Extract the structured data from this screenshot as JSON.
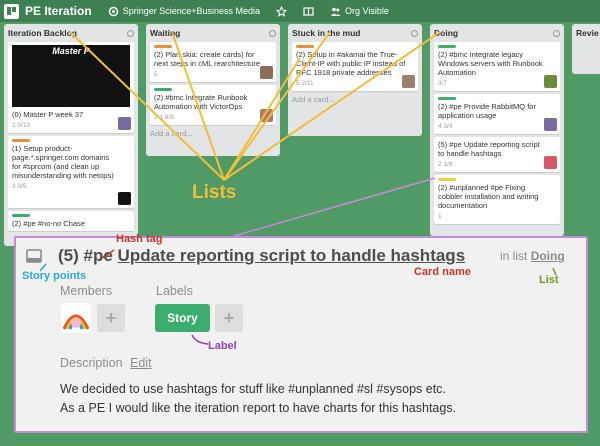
{
  "header": {
    "board_title": "PE Iteration",
    "org": "Springer Science+Business Media",
    "visibility": "Org Visible"
  },
  "lists": {
    "backlog": {
      "title": "Iteration Backlog",
      "cards": [
        {
          "cover_text": "Master P",
          "text": "(0) Master P week 37",
          "badges": "1   0/10"
        },
        {
          "text": "(1) Setup product-page.*.springer.com domains for #sprcom (and clean up misunderstanding with netops)",
          "badges": "3   0/5"
        },
        {
          "text": "(2) #pe #no-no Chase"
        }
      ]
    },
    "waiting": {
      "title": "Waiting",
      "cards": [
        {
          "text": "(2) Plan skia: create cards) for next steps in cML rearchitecture",
          "badges": "5"
        },
        {
          "text": "(2) #bmc Integrate Runbook Automation with VictorOps",
          "badges": "2   1   6/9"
        }
      ],
      "add": "Add a card..."
    },
    "stuck": {
      "title": "Stuck in the mud",
      "cards": [
        {
          "text": "(2) Setup in #akamai the True-Client-IP with public IP instead of RFC 1918 private addresses",
          "badges": "5   2/11"
        }
      ],
      "add": "Add a card..."
    },
    "doing": {
      "title": "Doing",
      "cards": [
        {
          "text": "(2) #bmc Integrate legacy Windows servers with Runbook Automation",
          "badges": "3/7"
        },
        {
          "text": "(2) #pe Provide RabbitMQ for application usage",
          "badges": "4   3/4"
        },
        {
          "text": "(5) #pe Update reporting script to handle hashtags",
          "badges": "2   1/8"
        },
        {
          "text": "(2) #unplanned #pe Fixing cobbler installation and writing documentation",
          "badges": "1"
        }
      ]
    },
    "review": {
      "title": "Revie"
    }
  },
  "annotations": {
    "lists": "Lists",
    "hash_tag": "Hash tag",
    "story_points": "Story points",
    "card_name": "Card name",
    "list": "List",
    "label": "Label"
  },
  "detail": {
    "points": "(5)",
    "hashtag": "#pe",
    "name": "Update reporting script to handle hashtags",
    "in_list_prefix": "in list",
    "list_name": "Doing",
    "members_label": "Members",
    "labels_label": "Labels",
    "label_value": "Story",
    "description_label": "Description",
    "edit_label": "Edit",
    "description_line1": "We decided to use hashtags for stuff like #unplanned #sl #sysops etc.",
    "description_line2": "As a PE I would like the iteration report to have charts for this hashtags."
  },
  "colors": {
    "board_bg": "#509a66",
    "label_green": "#3cad6e",
    "label_orange": "#e5913a",
    "label_yellow": "#f0cc38",
    "annotation_yellow": "#f2bd3b",
    "annotation_purple": "#c58bd5",
    "annotation_red": "#c0392b",
    "annotation_blue": "#2aa8d8",
    "annotation_olive": "#6b9a2a"
  }
}
